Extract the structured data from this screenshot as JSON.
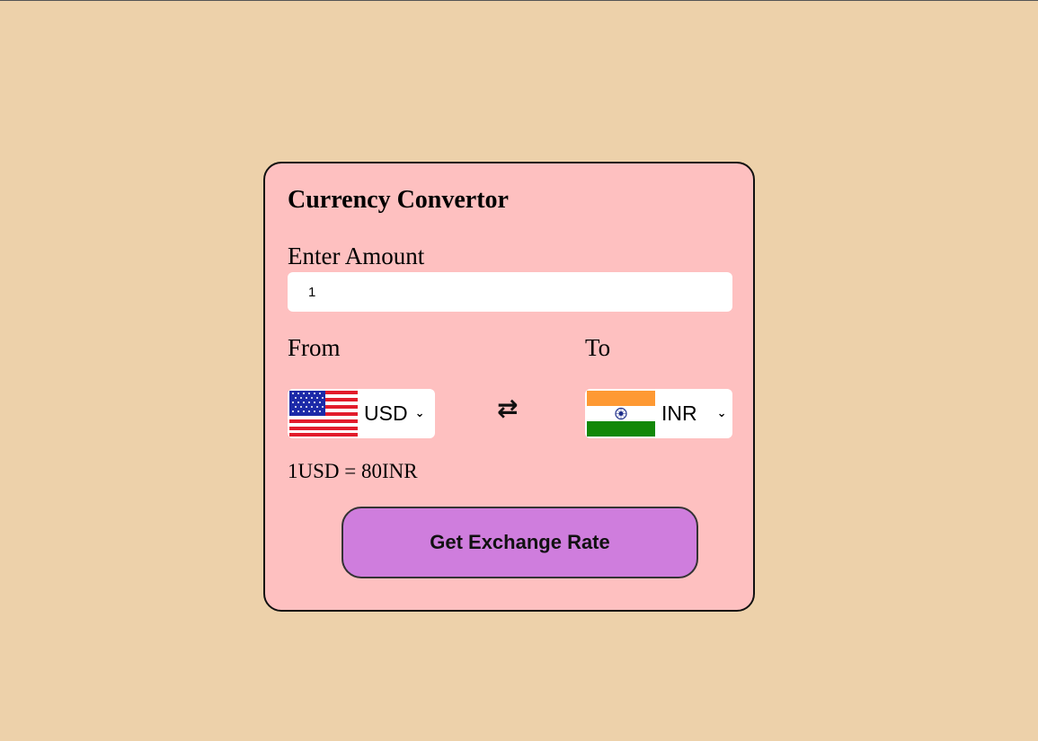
{
  "converter": {
    "title": "Currency Convertor",
    "amount_label": "Enter Amount",
    "amount_value": "1",
    "from_label": "From",
    "to_label": "To",
    "from_currency": "USD",
    "to_currency": "INR",
    "from_flag_icon": "us-flag-icon",
    "to_flag_icon": "india-flag-icon",
    "swap_icon": "swap-arrows-icon",
    "swap_glyph": "⇄",
    "dropdown_glyph": "⌄",
    "exchange_message": "1USD = 80INR",
    "button_label": "Get Exchange Rate"
  },
  "colors": {
    "page_background": "#edd1aa",
    "card_background": "#fec0c0",
    "button_background": "#cf7ddd"
  }
}
